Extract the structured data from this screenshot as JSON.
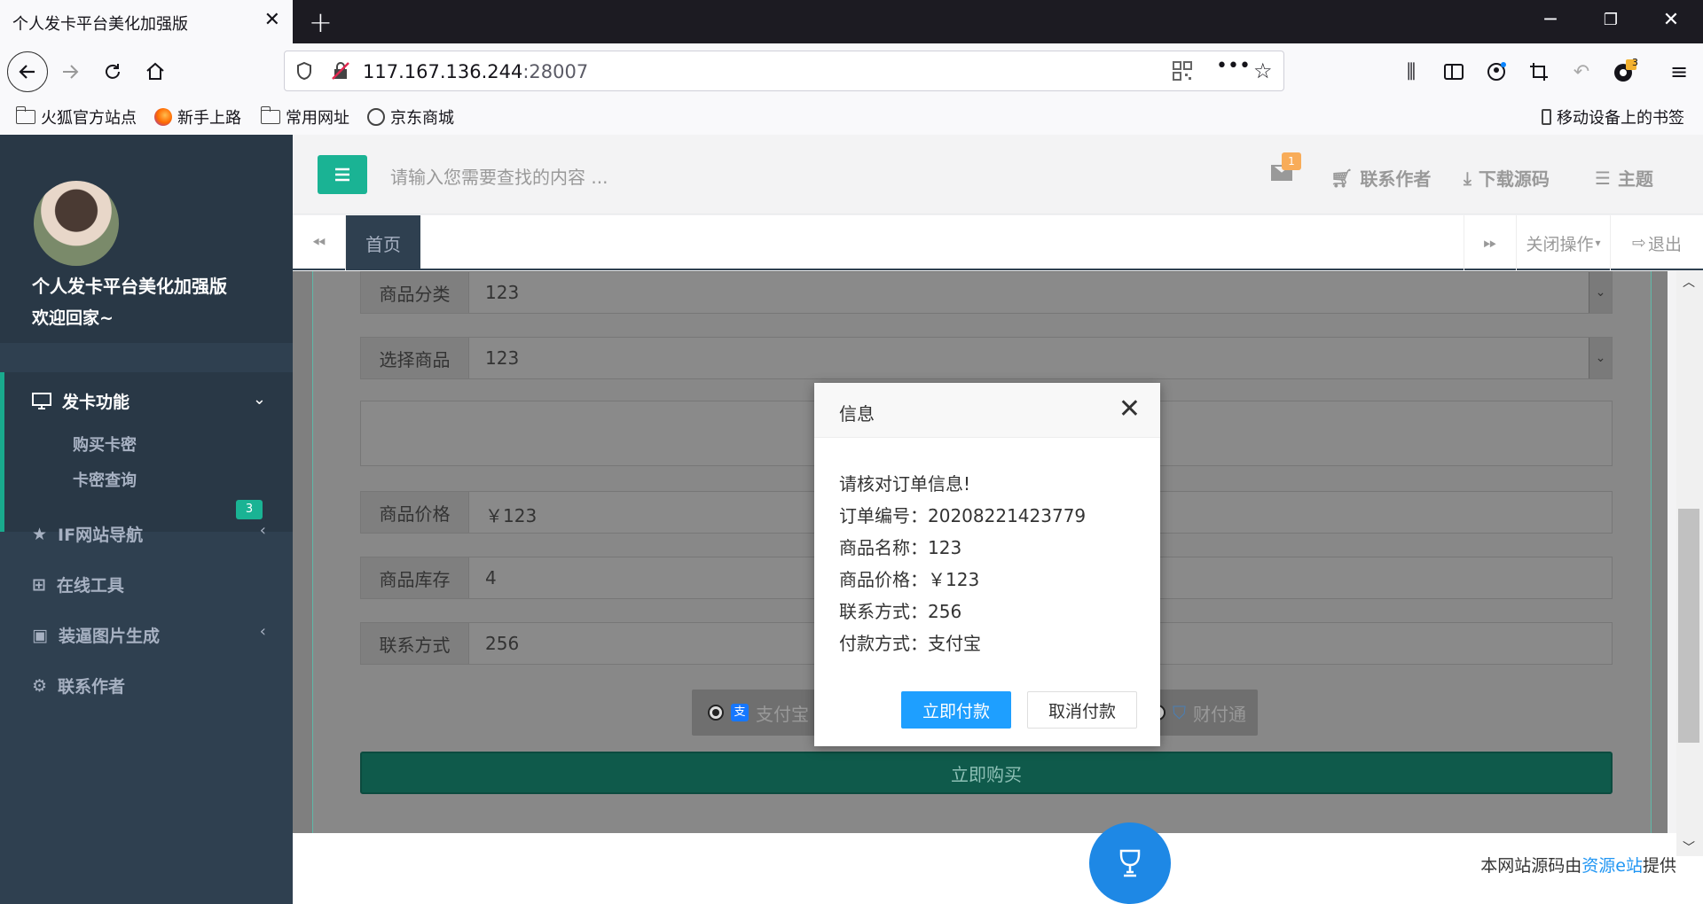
{
  "browser": {
    "tab_title": "个人发卡平台美化加强版",
    "url_host": "117.167.136.244",
    "url_port": ":28007",
    "addon_badge": "3",
    "bookmarks": [
      "火狐官方站点",
      "新手上路",
      "常用网址",
      "京东商城"
    ],
    "mobile_bookmarks": "移动设备上的书签"
  },
  "sidebar": {
    "site_name": "个人发卡平台美化加强版",
    "welcome": "欢迎回家~",
    "menu": {
      "card_function": "发卡功能",
      "buy_card": "购买卡密",
      "query_card": "卡密查询",
      "if_nav": "IF网站导航",
      "online_tools": "在线工具",
      "online_tools_badge": "3",
      "fake_image": "装逼图片生成",
      "contact": "联系作者"
    }
  },
  "topbar": {
    "search_placeholder": "请输入您需要查找的内容 ...",
    "mail_badge": "1",
    "contact_author": "联系作者",
    "download_source": "下载源码",
    "theme": "主题"
  },
  "tabs": {
    "home": "首页",
    "close_ops": "关闭操作",
    "logout": "退出"
  },
  "form": {
    "category_label": "商品分类",
    "category_value": "123",
    "product_label": "选择商品",
    "product_value": "123",
    "price_label": "商品价格",
    "price_value": "￥123",
    "stock_label": "商品库存",
    "stock_value": "4",
    "contact_label": "联系方式",
    "contact_value": "256",
    "pay_alipay": "支付宝",
    "pay_tenpay": "财付通",
    "buy_button": "立即购买"
  },
  "footer": {
    "prefix": "本网站源码由",
    "link": "资源e站",
    "suffix": "提供"
  },
  "modal": {
    "title": "信息",
    "line1": "请核对订单信息!",
    "line2": "订单编号：20208221423779",
    "line3": "商品名称：123",
    "line4": "商品价格：￥123",
    "line5": "联系方式：256",
    "line6": "付款方式：支付宝",
    "confirm": "立即付款",
    "cancel": "取消付款"
  }
}
